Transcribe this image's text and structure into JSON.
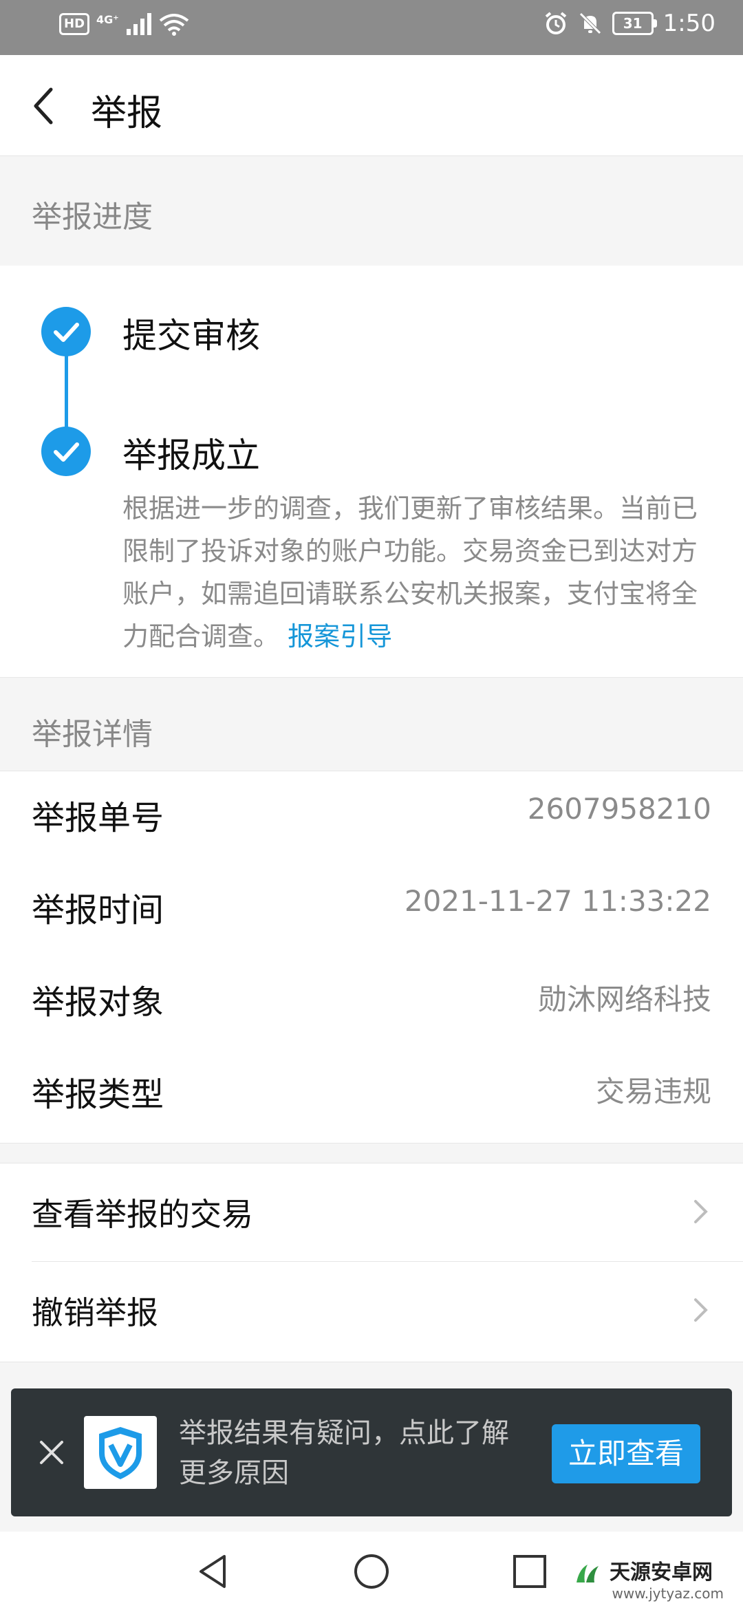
{
  "status_bar": {
    "hd_label": "HD",
    "network_label": "4G⁺",
    "battery_level": "31",
    "time": "1:50"
  },
  "header": {
    "title": "举报"
  },
  "progress_section": {
    "heading": "举报进度",
    "steps": [
      {
        "title": "提交审核"
      },
      {
        "title": "举报成立",
        "description": "根据进一步的调查，我们更新了审核结果。当前已限制了投诉对象的账户功能。交易资金已到达对方账户，如需追回请联系公安机关报案，支付宝将全力配合调查。",
        "link_text": "报案引导"
      }
    ]
  },
  "details_section": {
    "heading": "举报详情",
    "rows": [
      {
        "label": "举报单号",
        "value": "2607958210"
      },
      {
        "label": "举报时间",
        "value": "2021-11-27 11:33:22"
      },
      {
        "label": "举报对象",
        "value": "勋沐网络科技"
      },
      {
        "label": "举报类型",
        "value": "交易违规"
      }
    ]
  },
  "actions": [
    {
      "label": "查看举报的交易"
    },
    {
      "label": "撤销举报"
    }
  ],
  "banner": {
    "text": "举报结果有疑问，点此了解更多原因",
    "button_label": "立即查看"
  },
  "watermark": {
    "title": "天源安卓网",
    "url": "www.jytyaz.com"
  },
  "colors": {
    "accent": "#1d9be8",
    "banner_bg": "#2f3538"
  }
}
